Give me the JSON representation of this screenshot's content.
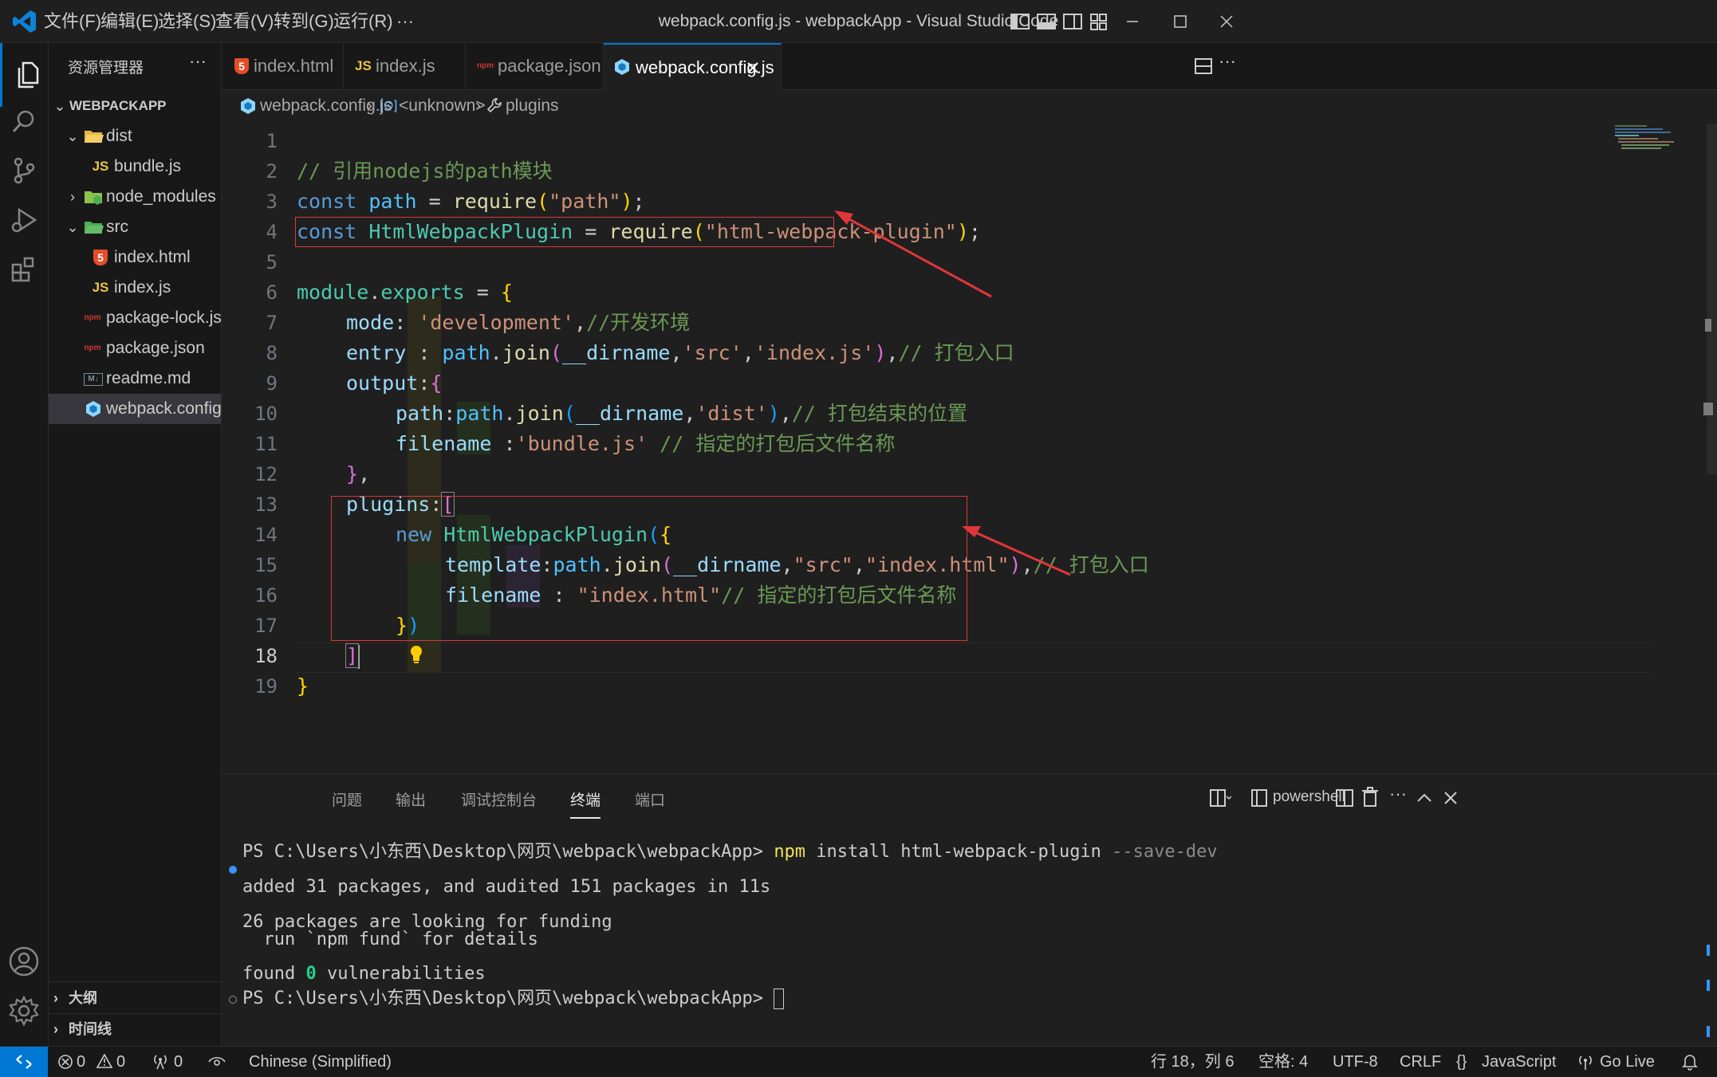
{
  "window": {
    "title": "webpack.config.js - webpackApp - Visual Studio Code",
    "menu": [
      "文件(F)",
      "编辑(E)",
      "选择(S)",
      "查看(V)",
      "转到(G)",
      "运行(R)",
      "···"
    ]
  },
  "sidebar": {
    "title": "资源管理器",
    "more": "···",
    "root": "WEBPACKAPP",
    "tree": [
      {
        "label": "dist",
        "type": "folder-open"
      },
      {
        "label": "bundle.js",
        "type": "js"
      },
      {
        "label": "node_modules",
        "type": "folder-closed"
      },
      {
        "label": "src",
        "type": "folder-open"
      },
      {
        "label": "index.html",
        "type": "html"
      },
      {
        "label": "index.js",
        "type": "js"
      },
      {
        "label": "package-lock.json",
        "type": "npm"
      },
      {
        "label": "package.json",
        "type": "npm"
      },
      {
        "label": "readme.md",
        "type": "md"
      },
      {
        "label": "webpack.config.js",
        "type": "webpack",
        "selected": true
      }
    ],
    "sections": [
      "大纲",
      "时间线"
    ]
  },
  "tabs": [
    {
      "label": "index.html",
      "icon": "html5-icon"
    },
    {
      "label": "index.js",
      "icon": "js-icon"
    },
    {
      "label": "package.json",
      "icon": "npm-icon"
    },
    {
      "label": "webpack.config.js",
      "icon": "webpack-icon",
      "active": true
    }
  ],
  "icon_text": {
    "js": "JS",
    "html5": "5",
    "npm": "npm",
    "md": "M↓"
  },
  "breadcrumb": {
    "file": "webpack.config.js",
    "symbol": "<unknown>",
    "property": "plugins"
  },
  "editor": {
    "current_line": 18,
    "line_numbers": [
      "1",
      "2",
      "3",
      "4",
      "5",
      "6",
      "7",
      "8",
      "9",
      "10",
      "11",
      "12",
      "13",
      "14",
      "15",
      "16",
      "17",
      "18",
      "19"
    ],
    "code": {
      "l2": "// 引用nodejs的path模块",
      "l3": {
        "kw": "const",
        "var": "path",
        "eq": " = ",
        "fn": "require",
        "arg": "\"path\"",
        "end": ";"
      },
      "l4": {
        "kw": "const",
        "cls": "HtmlWebpackPlugin",
        "eq": " = ",
        "fn": "require",
        "arg": "\"html-webpack-plugin\"",
        "end": ";"
      },
      "l6": {
        "obj": "module",
        "prop": "exports",
        "eq": " = "
      },
      "l7": {
        "key": "mode",
        "val": "'development'",
        "comment": "//开发环境"
      },
      "l8": {
        "key": "entry",
        "sep": " : ",
        "obj": "path",
        "fn": "join",
        "a1": "__dirname",
        "a2": "'src'",
        "a3": "'index.js'",
        "comment": "// 打包入口"
      },
      "l9": {
        "key": "output"
      },
      "l10": {
        "key": "path",
        "obj": "path",
        "fn": "join",
        "a1": "__dirname",
        "a2": "'dist'",
        "comment": "// 打包结束的位置"
      },
      "l11": {
        "key": "filename",
        "sep": " :",
        "val": "'bundle.js'",
        "comment": "// 指定的打包后文件名称"
      },
      "l13": {
        "key": "plugins"
      },
      "l14": {
        "kw": "new",
        "cls": "HtmlWebpackPlugin"
      },
      "l15": {
        "key": "template",
        "obj": "path",
        "fn": "join",
        "a1": "__dirname",
        "a2": "\"src\"",
        "a3": "\"index.html\"",
        "comment": "// 打包入口"
      },
      "l16": {
        "key": "filename",
        "sep": " : ",
        "val": "\"index.html\"",
        "comment": "// 指定的打包后文件名称"
      }
    }
  },
  "panel": {
    "tabs": [
      "问题",
      "输出",
      "调试控制台",
      "终端",
      "端口"
    ],
    "active_tab": "终端",
    "shell": "powershell",
    "terminal": {
      "prompt1": "PS C:\\Users\\小东西\\Desktop\\网页\\webpack\\webpackApp>",
      "cmd": "npm",
      "cmd_args": " install html-webpack-plugin",
      "cmd_flag": " --save-dev",
      "out1": "added 31 packages, and audited 151 packages in 11s",
      "out2": "26 packages are looking for funding",
      "out3": "  run `npm fund` for details",
      "out4_a": "found ",
      "out4_b": "0",
      "out4_c": " vulnerabilities",
      "prompt2": "PS C:\\Users\\小东西\\Desktop\\网页\\webpack\\webpackApp>"
    }
  },
  "statusbar": {
    "errors": "0",
    "warnings": "0",
    "ports": "0",
    "language_pack": "Chinese (Simplified)",
    "position": "行 18，列 6",
    "spaces": "空格: 4",
    "encoding": "UTF-8",
    "eol": "CRLF",
    "language": "JavaScript",
    "golive": "Go Live"
  },
  "colors": {
    "accent": "#0078d4",
    "annotation": "#e0363a",
    "comment": "#6a9955",
    "string": "#ce9178",
    "keyword": "#569cd6"
  }
}
